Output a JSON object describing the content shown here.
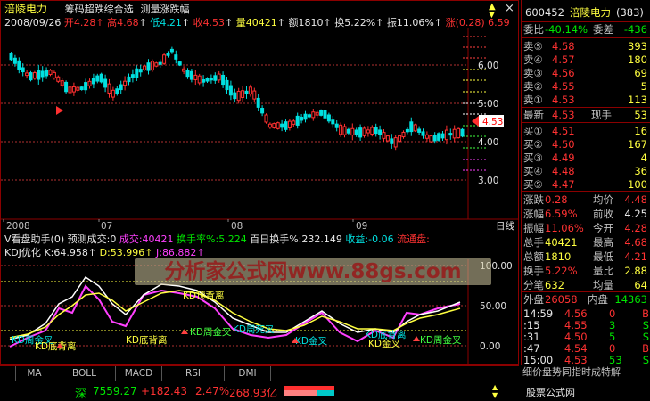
{
  "header": {
    "stock_name": "涪陵电力",
    "menu_1": "筹码超跌综合选",
    "menu_2": "测量涨跌幅",
    "date": "2008/09/26",
    "open_label": "开",
    "open": "4.28",
    "high_label": "高",
    "high": "4.68",
    "low_label": "低",
    "low": "4.21",
    "close_label": "收",
    "close": "4.53",
    "vol_label": "量",
    "vol": "40421",
    "amt_label": "额",
    "amt": "1810",
    "turn_label": "换",
    "turn": "5.22%",
    "amp_label": "振",
    "amp": "11.06%",
    "chg_label": "涨",
    "chg": "(0.28)",
    "chg_pct": "6.59"
  },
  "price_axis": [
    "6.00",
    "5.00",
    "4.00",
    "3.00"
  ],
  "price_marker": "4.53",
  "date_axis": [
    "2008",
    "07",
    "08",
    "09"
  ],
  "date_axis_right": "日线",
  "indicator": {
    "line1_name": "V看盘助手(0)",
    "line1_pred": "预测成交:0",
    "line1_vol_label": "成交:",
    "line1_vol": "40421",
    "line1_turn_label": "换手率%:",
    "line1_turn": "5.224",
    "line1_100_label": "百日换手%:",
    "line1_100": "232.149",
    "line1_profit_label": "收益:",
    "line1_profit": "-0.06",
    "line1_float_label": "流通盘:",
    "line2_name": "KDJ优化",
    "k_label": "K:",
    "k": "64.958",
    "d_label": "D:",
    "d": "53.996",
    "j_label": "J:",
    "j": "86.882",
    "axis": [
      "100.00",
      "50.00",
      "0.00"
    ],
    "annotations": [
      "KD周金叉",
      "KD底背离",
      "KD顶背离",
      "KD周金叉",
      "KD周死叉",
      "KD金叉",
      "KD底背离",
      "KD金叉",
      "KD周金叉",
      "KD底背离"
    ]
  },
  "watermark": "分析家公式网www.88gs.com",
  "tabs": [
    "MA",
    "BOLL",
    "MACD",
    "RSI",
    "DMI"
  ],
  "status": {
    "market": "深",
    "index": "7559.27",
    "change": "+182.43",
    "pct": "2.47%",
    "amount": "268.93亿",
    "ticker": "细价盘势同指时成特解",
    "site": "股票公式网 www.88gs.com"
  },
  "quote": {
    "code": "600452",
    "name": "涪陵电力",
    "count": "(383)",
    "weibi_label": "委比",
    "weibi": "-40.14%",
    "weicha_label": "委差",
    "weicha": "-436",
    "asks": [
      {
        "label": "卖⑤",
        "price": "4.58",
        "vol": "393"
      },
      {
        "label": "卖④",
        "price": "4.57",
        "vol": "180"
      },
      {
        "label": "卖③",
        "price": "4.56",
        "vol": "69"
      },
      {
        "label": "卖②",
        "price": "4.55",
        "vol": "5"
      },
      {
        "label": "卖①",
        "price": "4.53",
        "vol": "113"
      }
    ],
    "last_label": "最新",
    "last": "4.53",
    "cur_label": "现手",
    "cur": "53",
    "bids": [
      {
        "label": "买①",
        "price": "4.51",
        "vol": "16"
      },
      {
        "label": "买②",
        "price": "4.50",
        "vol": "167"
      },
      {
        "label": "买③",
        "price": "4.49",
        "vol": "4"
      },
      {
        "label": "买④",
        "price": "4.48",
        "vol": "36"
      },
      {
        "label": "买⑤",
        "price": "4.47",
        "vol": "100"
      }
    ],
    "stats": [
      {
        "l1": "涨跌",
        "v1": "0.28",
        "l2": "均价",
        "v2": "4.48"
      },
      {
        "l1": "涨幅",
        "v1": "6.59%",
        "l2": "前收",
        "v2": "4.25"
      },
      {
        "l1": "振幅",
        "v1": "11.06%",
        "l2": "今开",
        "v2": "4.28"
      },
      {
        "l1": "总手",
        "v1": "40421",
        "l2": "最高",
        "v2": "4.68"
      },
      {
        "l1": "总额",
        "v1": "1810",
        "l2": "最低",
        "v2": "4.21"
      },
      {
        "l1": "换手",
        "v1": "5.22%",
        "l2": "量比",
        "v2": "2.88"
      },
      {
        "l1": "分笔",
        "v1": "632",
        "l2": "均量",
        "v2": "64"
      }
    ],
    "outer_label": "外盘",
    "outer": "26058",
    "inner_label": "内盘",
    "inner": "14363",
    "ticks": [
      {
        "time": "14:59",
        "price": "4.56",
        "vol": "0",
        "side": "B"
      },
      {
        "time": ":15",
        "price": "4.55",
        "vol": "3",
        "side": "S"
      },
      {
        "time": ":31",
        "price": "4.50",
        "vol": "5",
        "side": "S"
      },
      {
        "time": ":47",
        "price": "4.54",
        "vol": "0",
        "side": "B"
      },
      {
        "time": "15:00",
        "price": "4.53",
        "vol": "53",
        "side": "S"
      }
    ]
  }
}
